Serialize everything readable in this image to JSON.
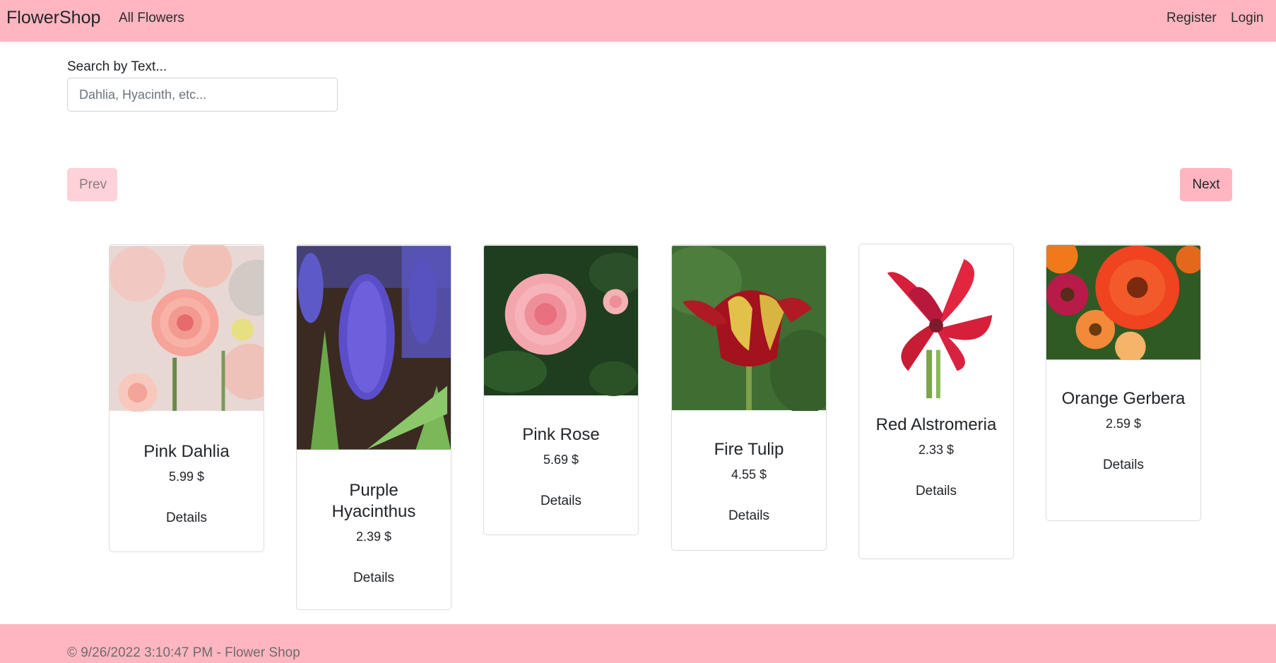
{
  "nav": {
    "brand": "FlowerShop",
    "all_flowers": "All Flowers",
    "register": "Register",
    "login": "Login"
  },
  "search": {
    "label": "Search by Text...",
    "placeholder": "Dahlia, Hyacinth, etc...",
    "value": ""
  },
  "pager": {
    "prev": "Prev",
    "next": "Next"
  },
  "flowers": [
    {
      "name": "Pink Dahlia",
      "price": "5.99 $",
      "details": "Details",
      "image": "pink-dahlia-photo"
    },
    {
      "name": "Purple Hyacinthus",
      "price": "2.39 $",
      "details": "Details",
      "image": "purple-hyacinth-photo"
    },
    {
      "name": "Pink Rose",
      "price": "5.69 $",
      "details": "Details",
      "image": "pink-rose-photo"
    },
    {
      "name": "Fire Tulip",
      "price": "4.55 $",
      "details": "Details",
      "image": "fire-tulip-photo"
    },
    {
      "name": "Red Alstromeria",
      "price": "2.33 $",
      "details": "Details",
      "image": "red-alstroemeria-photo"
    },
    {
      "name": "Orange Gerbera",
      "price": "2.59 $",
      "details": "Details",
      "image": "orange-gerbera-photo"
    }
  ],
  "footer": {
    "text": "© 9/26/2022 3:10:47 PM - Flower Shop"
  },
  "colors": {
    "navbar_bg": "#ffb6c1",
    "prev_bg": "#ffd1d9",
    "next_bg": "#ffb6c1"
  }
}
